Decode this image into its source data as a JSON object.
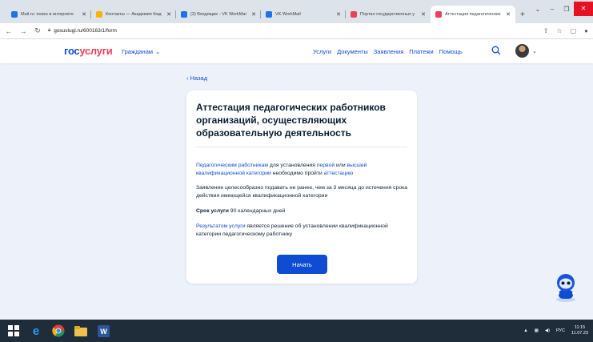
{
  "browser": {
    "tabs": [
      {
        "label": "Mail.ru: поиск в интернете",
        "color": "#1a73e8"
      },
      {
        "label": "Контакты — Академия бюд",
        "color": "#f4b400"
      },
      {
        "label": "(2) Входящие - VK WorkMail",
        "color": "#1a73e8"
      },
      {
        "label": "VK WorkMail",
        "color": "#1a73e8"
      },
      {
        "label": "Портал государственных у",
        "color": "#ee3f58"
      },
      {
        "label": "Аттестация педагогических",
        "color": "#ee3f58"
      }
    ],
    "url": "gosuslugi.ru/600163/1/form"
  },
  "header": {
    "logo_part1": "гос",
    "logo_part2": "услуги",
    "citizens": "Гражданам",
    "nav": [
      "Услуги",
      "Документы",
      "Заявления",
      "Платежи",
      "Помощь"
    ]
  },
  "page": {
    "back": "‹ Назад",
    "title": "Аттестация педагогических работников организаций, осуществляющих образовательную деятельность",
    "p1": {
      "link1": "Педагогическим работникам",
      "text1": " для установления ",
      "link2": "первой",
      "text2": " или ",
      "link3": "высшей квалификационной категории",
      "text3": " необходимо пройти ",
      "link4": "аттестацию"
    },
    "p2": "Заявление целесообразно подавать не ранее, чем за 3 месяца до истечения срока действия имеющейся квалификационной категории",
    "p3": {
      "bold": "Срок услуги",
      "text": " 90 календарных дней"
    },
    "p4": {
      "link": "Результатом услуги",
      "text": " является решение об установлении квалификационной категории педагогическому работнику"
    },
    "start_button": "Начать"
  },
  "taskbar": {
    "lang": "РУС",
    "time": "11:15",
    "date": "11.07.23"
  }
}
